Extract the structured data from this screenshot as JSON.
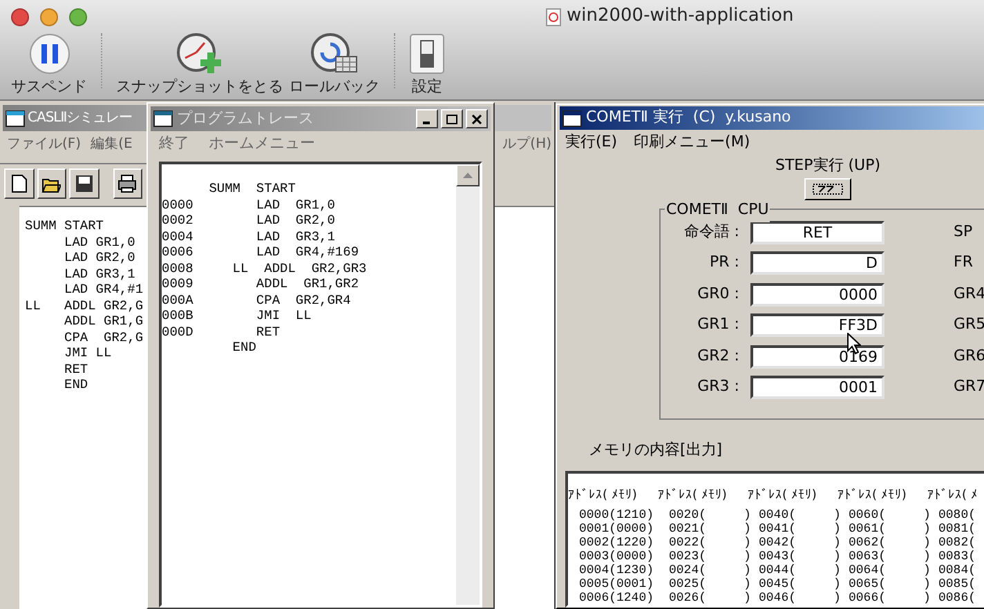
{
  "window": {
    "title": "win2000-with-application"
  },
  "toolbar": [
    {
      "label": "サスペンド",
      "kind": "pause"
    },
    {
      "label": "スナップショットをとる",
      "kind": "snapshot"
    },
    {
      "label": "ロールバック",
      "kind": "rollback"
    },
    {
      "label": "設定",
      "kind": "settings"
    }
  ],
  "casl_window": {
    "title": "CASLⅡシミュレー",
    "menu": [
      "ファイル(F)",
      "編集(E"
    ],
    "menu_right": "ルプ(H)",
    "listing": [
      "SUMM START",
      "     LAD GR1,0",
      "     LAD GR2,0",
      "     LAD GR3,1",
      "     LAD GR4,#1",
      "LL   ADDL GR2,G",
      "     ADDL GR1,G",
      "     CPA  GR2,G",
      "     JMI LL",
      "     RET",
      "     END"
    ]
  },
  "trace_window": {
    "title": "プログラムトレース",
    "menu": [
      "終了",
      "ホームメニュー"
    ],
    "listing": [
      "      SUMM  START",
      "0000        LAD  GR1,0",
      "0002        LAD  GR2,0",
      "0004        LAD  GR3,1",
      "0006        LAD  GR4,#169",
      "0008     LL  ADDL  GR2,GR3",
      "0009        ADDL  GR1,GR2",
      "000A        CPA  GR2,GR4",
      "000B        JMI  LL",
      "000D        RET",
      "         END"
    ]
  },
  "comet_window": {
    "title": "COMETⅡ 実行  (C)  y.kusano",
    "menu": [
      "実行(E)",
      "印刷メニュー(M)"
    ],
    "step_label": "STEP実行 (UP)",
    "cpu": {
      "legend": "COMETⅡ  CPU",
      "registers": [
        {
          "label": "命令語 :",
          "value": "RET",
          "kind": "instruction"
        },
        {
          "label": "PR :",
          "value": "D",
          "kind": "register"
        },
        {
          "label": "GR0 :",
          "value": "0000",
          "kind": "register"
        },
        {
          "label": "GR1 :",
          "value": "FF3D",
          "kind": "register"
        },
        {
          "label": "GR2 :",
          "value": "0169",
          "kind": "register"
        },
        {
          "label": "GR3 :",
          "value": "0001",
          "kind": "register"
        }
      ],
      "right_labels": [
        "SP",
        "FR",
        "GR4",
        "GR5",
        "GR6",
        "GR7"
      ]
    },
    "memory": {
      "label": "メモリの内容[出力]",
      "columns": [
        {
          "header": "ｱﾄﾞﾚｽ( ﾒﾓﾘ)",
          "cells": [
            "0000(1210)",
            "0001(0000)",
            "0002(1220)",
            "0003(0000)",
            "0004(1230)",
            "0005(0001)",
            "0006(1240)"
          ]
        },
        {
          "header": "ｱﾄﾞﾚｽ( ﾒﾓﾘ)",
          "cells": [
            "0020(     )",
            "0021(     )",
            "0022(     )",
            "0023(     )",
            "0024(     )",
            "0025(     )",
            "0026(     )"
          ]
        },
        {
          "header": "ｱﾄﾞﾚｽ( ﾒﾓﾘ)",
          "cells": [
            "0040(     )",
            "0041(     )",
            "0042(     )",
            "0043(     )",
            "0044(     )",
            "0045(     )",
            "0046(     )"
          ]
        },
        {
          "header": "ｱﾄﾞﾚｽ( ﾒﾓﾘ)",
          "cells": [
            "0060(     )",
            "0061(     )",
            "0062(     )",
            "0063(     )",
            "0064(     )",
            "0065(     )",
            "0066(     )"
          ]
        },
        {
          "header": "ｱﾄﾞﾚｽ( ﾒ",
          "cells": [
            "0080(",
            "0081(",
            "0082(",
            "0083(",
            "0084(",
            "0085(",
            "0086("
          ]
        }
      ]
    }
  }
}
